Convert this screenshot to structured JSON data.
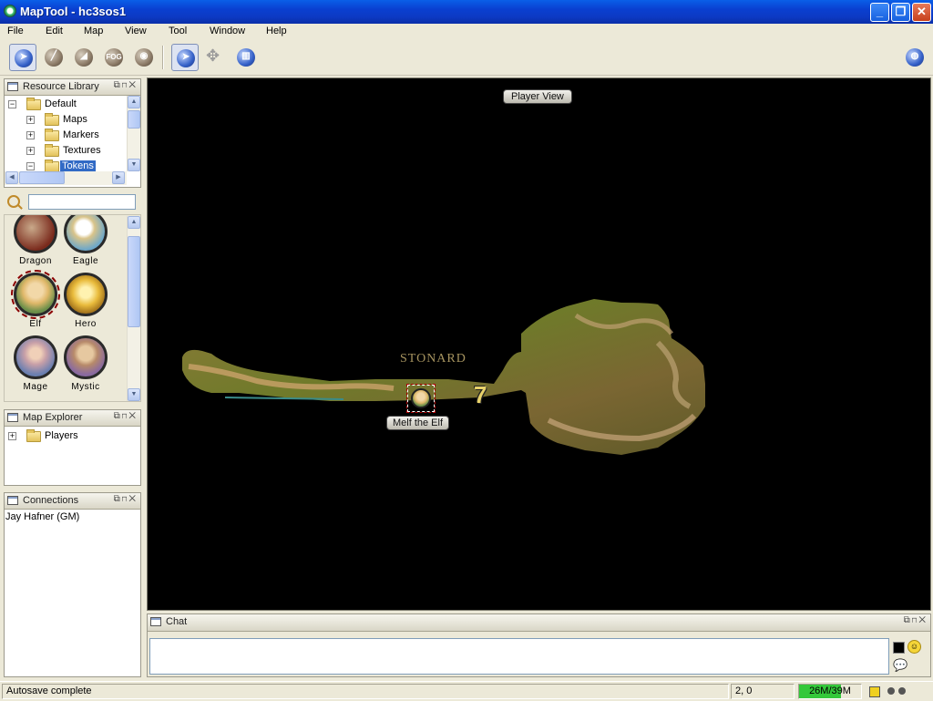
{
  "window": {
    "title": "MapTool - hc3sos1",
    "controls": [
      "minimize-icon",
      "maximize-icon",
      "close-icon"
    ]
  },
  "menu": [
    "File",
    "Edit",
    "Map",
    "View",
    "Tool",
    "Window",
    "Help"
  ],
  "toolbar": {
    "tools": [
      {
        "name": "pointer-tool",
        "icon": "pointer-icon",
        "selected": true
      },
      {
        "name": "draw-tool",
        "icon": "pencil-icon"
      },
      {
        "name": "template-tool",
        "icon": "brush-icon"
      },
      {
        "name": "fog-tool",
        "icon": "fog-icon",
        "label": "FOG"
      },
      {
        "name": "vision-tool",
        "icon": "eye-icon"
      }
    ],
    "pointer_subtools": [
      {
        "name": "select-tool",
        "icon": "pointer-icon",
        "selected": true
      },
      {
        "name": "move-tool",
        "icon": "move-arrows-icon"
      },
      {
        "name": "measure-tool",
        "icon": "measure-icon"
      }
    ],
    "connection_icon": "globe-icon"
  },
  "resource_library": {
    "title": "Resource Library",
    "tree": [
      {
        "label": "Default",
        "expanded": true,
        "level": 0
      },
      {
        "label": "Maps",
        "level": 1
      },
      {
        "label": "Markers",
        "level": 1
      },
      {
        "label": "Textures",
        "level": 1
      },
      {
        "label": "Tokens",
        "level": 1,
        "selected": true
      }
    ],
    "search_value": "",
    "tokens": [
      {
        "label": "Dragon",
        "color": "#7a2a1c"
      },
      {
        "label": "Eagle",
        "color": "#6fa8c8"
      },
      {
        "label": "Elf",
        "color": "#6b8f4a",
        "selected": true
      },
      {
        "label": "Hero",
        "color": "#d9a73a"
      },
      {
        "label": "Mage",
        "color": "#6b7fb0"
      },
      {
        "label": "Mystic",
        "color": "#8a6aa0"
      }
    ]
  },
  "map_explorer": {
    "title": "Map Explorer",
    "tree": [
      {
        "label": "Players",
        "expanded": false
      }
    ]
  },
  "connections": {
    "title": "Connections",
    "users": [
      "Jay Hafner (GM)"
    ]
  },
  "map": {
    "view_label": "Player View",
    "map_text": "STONARD",
    "map_number": "7",
    "token_label": "Melf the Elf"
  },
  "chat": {
    "title": "Chat",
    "message": "",
    "icons": [
      "text-color-icon",
      "smiley-icon",
      "speech-bubble-icon"
    ]
  },
  "status": {
    "message": "Autosave complete",
    "coords": "2, 0",
    "memory": "26M/39M",
    "memory_used_fraction": 0.67
  },
  "colors": {
    "titlebar": "#0a3fd0",
    "panel_bg": "#ece9d8",
    "selection": "#316ac5",
    "map_bg": "#000000"
  }
}
